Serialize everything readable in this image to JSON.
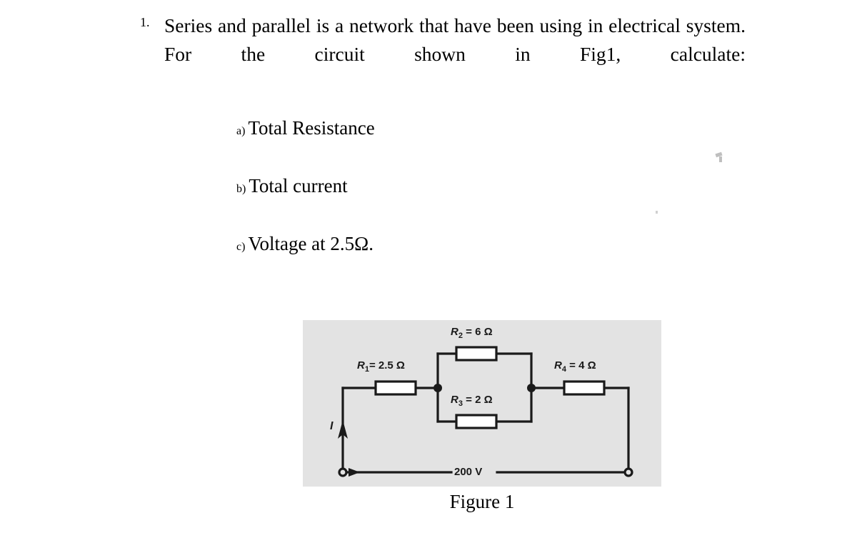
{
  "question": {
    "number": "1.",
    "text": "Series and parallel is a network that have been using in electrical system. For the circuit shown in Fig1, calculate:",
    "sub_items": [
      {
        "marker": "a)",
        "label": "Total Resistance"
      },
      {
        "marker": "b)",
        "label": "Total current"
      },
      {
        "marker": "c)",
        "label": "Voltage at 2.5Ω."
      }
    ]
  },
  "figure": {
    "caption": "Figure 1",
    "panel_color": "#e3e3e3",
    "wire_color": "#1a1a1a",
    "resistor_fill": "#ffffff",
    "labels": {
      "r1": "R",
      "r1_sub": "1",
      "r1_value": "= 2.5 Ω",
      "r2": "R",
      "r2_sub": "2",
      "r2_value": "= 6 Ω",
      "r3": "R",
      "r3_sub": "3",
      "r3_value": "= 2 Ω",
      "r4": "R",
      "r4_sub": "4",
      "r4_value": "= 4 Ω",
      "source": "200 V",
      "current": "I"
    },
    "components": [
      {
        "id": "R1",
        "label": "R1 = 2.5 Ω",
        "resistance_ohms": 2.5,
        "position": "series-left"
      },
      {
        "id": "R2",
        "label": "R2 = 6 Ω",
        "resistance_ohms": 6,
        "position": "parallel-top"
      },
      {
        "id": "R3",
        "label": "R3 = 2 Ω",
        "resistance_ohms": 2,
        "position": "parallel-bottom"
      },
      {
        "id": "R4",
        "label": "R4 = 4 Ω",
        "resistance_ohms": 4,
        "position": "series-right"
      }
    ],
    "source_voltage_volts": 200,
    "current_symbol": "I"
  }
}
